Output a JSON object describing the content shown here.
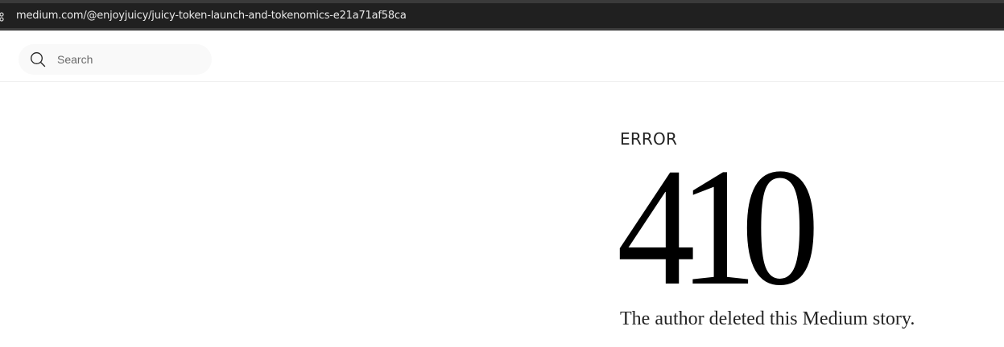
{
  "browser": {
    "url": "medium.com/@enjoyjuicy/juicy-token-launch-and-tokenomics-e21a71af58ca",
    "site_info_icon": "tune-icon"
  },
  "header": {
    "search": {
      "icon": "search-icon",
      "placeholder": "Search",
      "value": ""
    }
  },
  "error": {
    "label": "ERROR",
    "code": "410",
    "message": "The author deleted this Medium story."
  },
  "colors": {
    "browser_bar": "#202020",
    "url_text": "#e8e8e8",
    "search_bg": "#f9f9f9",
    "text_primary": "#242424",
    "error_code": "#000000"
  }
}
